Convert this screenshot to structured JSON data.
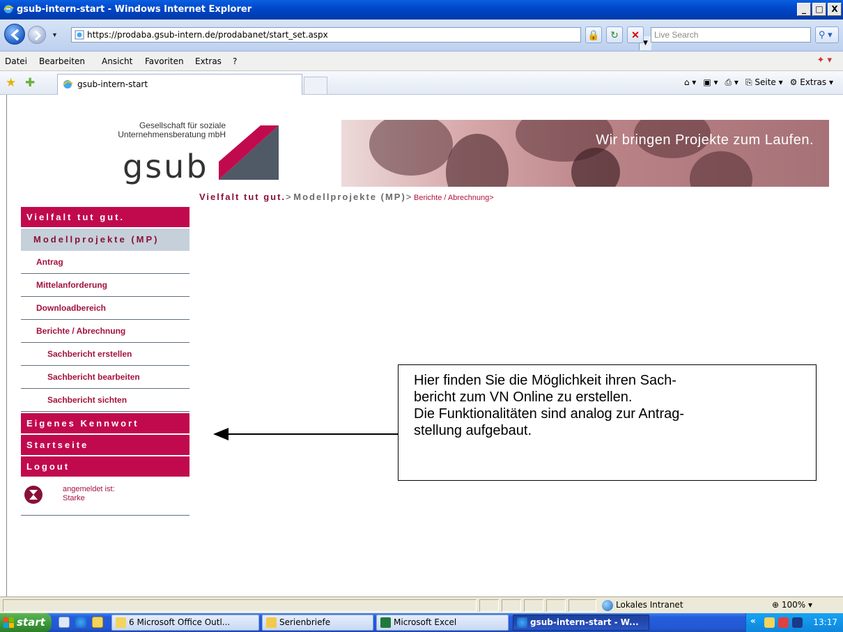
{
  "window": {
    "title": "gsub-intern-start - Windows Internet Explorer",
    "min": "_",
    "max": "□",
    "close": "X"
  },
  "address": {
    "url": "https://prodaba.gsub-intern.de/prodabanet/start_set.aspx",
    "search_placeholder": "Live Search"
  },
  "menu": {
    "items": [
      "Datei",
      "Bearbeiten",
      "Ansicht",
      "Favoriten",
      "Extras",
      "?"
    ]
  },
  "tabs": {
    "active_tab": "gsub-intern-start",
    "cmd": [
      "Seite ▾",
      "Extras ▾"
    ]
  },
  "page": {
    "company_line1": "Gesellschaft für soziale",
    "company_line2": "Unternehmensberatung mbH",
    "logo_text": "gsub",
    "banner_tagline": "Wir bringen Projekte zum Laufen.",
    "breadcrumb": {
      "c1": "Vielfalt tut gut.",
      "s1": ">",
      "c2": "Modellprojekte (MP)",
      "s2": ">",
      "c3": "Berichte / Abrechnung>"
    },
    "sidebar": {
      "head1": "Vielfalt tut gut.",
      "sub1": "Modellprojekte (MP)",
      "items": [
        "Antrag",
        "Mittelanforderung",
        "Downloadbereich",
        "Berichte / Abrechnung"
      ],
      "subitems": [
        "Sachbericht erstellen",
        "Sachbericht bearbeiten",
        "Sachbericht sichten"
      ],
      "kennwort": "Eigenes Kennwort",
      "startseite": "Startseite",
      "logout": "Logout",
      "user_label": "angemeldet ist:",
      "user_name": "Starke"
    },
    "callout": {
      "line1": "Hier finden Sie die Möglichkeit ihren Sach-",
      "line2": "bericht zum VN Online zu erstellen.",
      "line3": "Die Funktionalitäten sind analog zur Antrag-",
      "line4": "stellung aufgebaut."
    }
  },
  "status": {
    "zone": "Lokales Intranet",
    "zoom": "100%"
  },
  "taskbar": {
    "start": "start",
    "tasks": [
      "6 Microsoft Office Outl...",
      "Serienbriefe",
      "Microsoft Excel",
      "gsub-intern-start - W..."
    ],
    "clock": "13:17"
  },
  "colors": {
    "accent": "#c10a4e",
    "nav_sub_bg": "#c6d0da",
    "link": "#a3123d"
  }
}
